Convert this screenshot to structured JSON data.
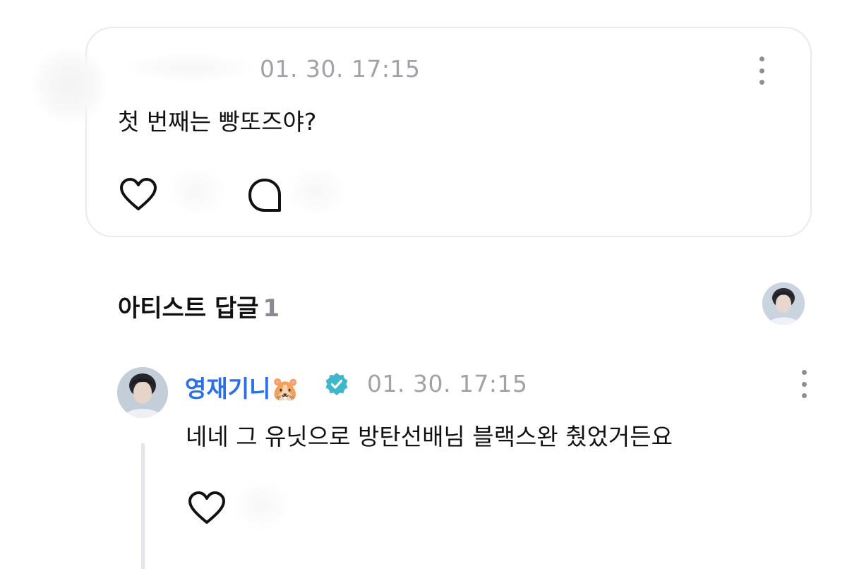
{
  "post": {
    "timestamp": "01. 30. 17:15",
    "text": "첫 번째는 빵또즈야?"
  },
  "section": {
    "title": "아티스트 답글",
    "count": "1"
  },
  "reply": {
    "name": "영재기니🐹",
    "timestamp": "01. 30. 17:15",
    "text": "네네 그 유닛으로 방탄선배님 블랙스완 췄었거든요"
  },
  "colors": {
    "accent_name": "#2a6fe4",
    "verified_badge": "#3fb6c9",
    "muted_text": "#a1a1a8",
    "card_border": "#e9e9ee"
  },
  "icons": {
    "like": "heart-outline-icon",
    "comment": "speech-bubble-icon",
    "more": "vertical-ellipsis-icon",
    "verified": "verified-badge-icon"
  }
}
